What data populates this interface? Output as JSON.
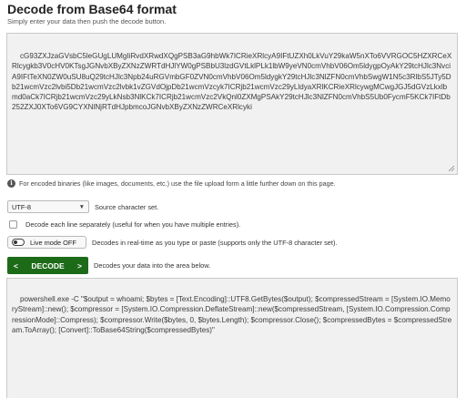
{
  "header": {
    "title": "Decode from Base64 format",
    "subtitle": "Simply enter your data then push the decode button."
  },
  "input": {
    "value": "cG93ZXJzaGVsbC5leGUgLUMgIiRvdXRwdXQgPSB3aG9hbWk7ICRieXRlcyA9IFtUZXh0LkVuY29kaW5nXTo6VVRGOC5HZXRCeXRlcygkb3V0cHV0KTsgJGNvbXByZXNzZWRTdHJlYW0gPSBbU3lzdGVtLklPLk1lbW9yeVN0cmVhbV06Om5ldygpOyAkY29tcHJlc3NvciA9IFtTeXN0ZW0uSU8uQ29tcHJlc3Npb24uRGVmbGF0ZVN0cmVhbV06Om5ldygkY29tcHJlc3NlZFN0cmVhbSwgW1N5c3RlbS5JTy5Db21wcmVzc2lvbi5Db21wcmVzc2lvbk1vZGVdOjpDb21wcmVzcyk7ICRjb21wcmVzc29yLldyaXRlKCRieXRlcywgMCwgJGJ5dGVzLkxlbmd0aCk7ICRjb21wcmVzc29yLkNsb3NlKCk7ICRjb21wcmVzc2VkQnl0ZXMgPSAkY29tcHJlc3NlZFN0cmVhbS5Ub0FycmF5KCk7IFtDb252ZXJ0XTo6VG9CYXNlNjRTdHJpbmcoJGNvbXByZXNzZWRCeXRlcyki"
  },
  "info": {
    "text": "For encoded binaries (like images, documents, etc.) use the file upload form a little further down on this page."
  },
  "charset": {
    "selected": "UTF-8",
    "label": "Source character set."
  },
  "lines_option": {
    "label": "Decode each line separately (useful for when you have multiple entries)."
  },
  "live_mode": {
    "button_label": "Live mode OFF",
    "label": "Decodes in real-time as you type or paste (supports only the UTF-8 character set)."
  },
  "decode": {
    "button_label": "DECODE",
    "left_arrow": "<",
    "right_arrow": ">",
    "label": "Decodes your data into the area below."
  },
  "output": {
    "value": "powershell.exe -C \"$output = whoami; $bytes = [Text.Encoding]::UTF8.GetBytes($output); $compressedStream = [System.IO.MemoryStream]::new(); $compressor = [System.IO.Compression.DeflateStream]::new($compressedStream, [System.IO.Compression.CompressionMode]::Compress); $compressor.Write($bytes, 0, $bytes.Length); $compressor.Close(); $compressedBytes = $compressedStream.ToArray(); [Convert]::ToBase64String($compressedBytes)\""
  },
  "colors": {
    "decode_button": "#1d6b19",
    "textarea_bg": "#f1f1f1"
  },
  "icons": {
    "info": "info-icon",
    "dropdown": "chevron-down-icon",
    "resize": "resize-grip-icon"
  }
}
